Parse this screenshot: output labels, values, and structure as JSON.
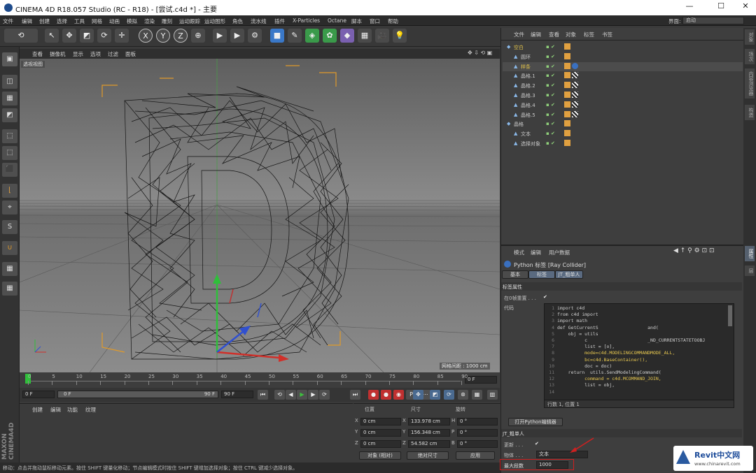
{
  "app": {
    "title": "CINEMA 4D R18.057 Studio (RC - R18) - [尝试.c4d *] - 主要",
    "interface_label": "界面:",
    "interface_value": "启动"
  },
  "menu": [
    "文件",
    "编辑",
    "创建",
    "选择",
    "工具",
    "网格",
    "动画",
    "模拟",
    "渲染",
    "雕刻",
    "运动跟踪",
    "运动图形",
    "角色",
    "流水线",
    "插件",
    "X-Particles",
    "Octane",
    "脚本",
    "窗口",
    "帮助"
  ],
  "toolbar_icons": [
    "undo-icon",
    "select-live-icon",
    "move-icon",
    "scale-icon",
    "rotate-icon",
    "last-tool-icon",
    "x-axis-icon",
    "y-axis-icon",
    "z-axis-icon",
    "coordinate-system-icon",
    "render-view-icon",
    "render-picture-viewer-icon",
    "edit-render-settings-icon",
    "cube-icon",
    "pen-spline-icon",
    "subdivision-icon",
    "cloner-icon",
    "deformer-icon",
    "floor-icon",
    "camera-icon",
    "light-icon"
  ],
  "toolbar_glyphs": [
    "⟲",
    "↖",
    "✥",
    "◩",
    "⟳",
    "✛",
    "X",
    "Y",
    "Z",
    "⊕",
    "▶",
    "▶",
    "⚙",
    "■",
    "✎",
    "◈",
    "✿",
    "◆",
    "▦",
    "🎥",
    "💡"
  ],
  "viewport": {
    "menu": [
      "查看",
      "摄像机",
      "显示",
      "选项",
      "过滤",
      "面板"
    ],
    "label": "透视视图",
    "grid_spacing": "网格间距 : 1000 cm"
  },
  "timeline": {
    "ticks": [
      "0",
      "5",
      "10",
      "15",
      "20",
      "25",
      "30",
      "35",
      "40",
      "45",
      "50",
      "55",
      "60",
      "65",
      "70",
      "75",
      "80",
      "85",
      "90"
    ],
    "frame_field": "0 F",
    "start_field": "0 F",
    "min_field": "0 F",
    "max_field": "90 F",
    "end_field": "90 F"
  },
  "material": {
    "menu": [
      "创建",
      "编辑",
      "功能",
      "纹理"
    ]
  },
  "coords": {
    "headers": [
      "位置",
      "尺寸",
      "旋转"
    ],
    "rows": [
      {
        "axis": "X",
        "pos": "0 cm",
        "size": "133.978 cm",
        "rot_label": "H",
        "rot": "0 °"
      },
      {
        "axis": "Y",
        "pos": "0 cm",
        "size": "156.348 cm",
        "rot_label": "P",
        "rot": "0 °"
      },
      {
        "axis": "Z",
        "pos": "0 cm",
        "size": "54.582 cm",
        "rot_label": "B",
        "rot": "0 °"
      }
    ],
    "mode": "对象 (相对)",
    "size_mode": "绝对尺寸",
    "apply": "应用"
  },
  "status": "移动：点击并拖动鼠标移动元素。按住 SHIFT 键量化移动；节点编辑模式时按住 SHIFT 键增加选择对象；按住 CTRL 键减少选择对象。",
  "objmgr": {
    "menu": [
      "文件",
      "编辑",
      "查看",
      "对象",
      "标签",
      "书签"
    ],
    "objects": [
      {
        "name": "空白",
        "indent": 0,
        "color": "#e0c24a"
      },
      {
        "name": "圆环",
        "indent": 1,
        "color": "#c8c8c8"
      },
      {
        "name": "样条",
        "indent": 1,
        "color": "#e0c24a"
      },
      {
        "name": "晶格.1",
        "indent": 1,
        "color": "#c8c8c8"
      },
      {
        "name": "晶格.2",
        "indent": 1,
        "color": "#c8c8c8"
      },
      {
        "name": "晶格.3",
        "indent": 1,
        "color": "#c8c8c8"
      },
      {
        "name": "晶格.4",
        "indent": 1,
        "color": "#c8c8c8"
      },
      {
        "name": "晶格.5",
        "indent": 1,
        "color": "#c8c8c8"
      },
      {
        "name": "晶格",
        "indent": 0,
        "color": "#c8c8c8"
      },
      {
        "name": "文本",
        "indent": 1,
        "color": "#c8c8c8"
      },
      {
        "name": "选择对象",
        "indent": 1,
        "color": "#c8c8c8"
      }
    ]
  },
  "attr": {
    "menu": [
      "模式",
      "编辑",
      "用户数据"
    ],
    "title": "Python 标签 [Ray Collider]",
    "tabs": [
      "基本",
      "标签",
      "JT_粗单人"
    ],
    "section": "标签属性",
    "enable_label": "在0帧重置 . . .",
    "code_label": "代码",
    "code_lines": [
      "import c4d",
      "from c4d import",
      "import math",
      "",
      "def GetCurrentS                  and(",
      "    obj = utils                    ",
      "          c                      _ND_CURRENTSTATETOOBJ",
      "          list = [o],",
      "          mode=c4d.MODELINGCOMMANDMODE_ALL,",
      "          bc=c4d.BaseContainer(),",
      "          doc = doc)",
      "    return  utils.SendModelingCommand(",
      "          command = c4d.MCOMMAND_JOIN,",
      "          list = obj,"
    ],
    "line_numbers": [
      "1",
      "2",
      "3",
      "4",
      "5",
      "6",
      "7",
      "8",
      "9",
      "10",
      "11",
      "12",
      "13",
      "14"
    ],
    "cursor_info": "行数 1, 位置 1",
    "open_editor": "打开Python编辑器",
    "user_section": "JT_粗单人",
    "update_label": "更新 . . .",
    "object_label": "物体 . . .",
    "object_value": "文本",
    "max_label": "最大段数",
    "max_value": "1000"
  },
  "right_tabs": [
    "对象",
    "场次",
    "内容浏览器",
    "构造",
    "属性",
    "层"
  ],
  "watermark": {
    "brand": "Revit中文网",
    "url": "www.chinarevit.com"
  },
  "colors": {
    "accent_orange": "#e09a2a",
    "axis_green": "#2fbf3a",
    "axis_red": "#d0302a",
    "axis_blue": "#3050d0"
  }
}
